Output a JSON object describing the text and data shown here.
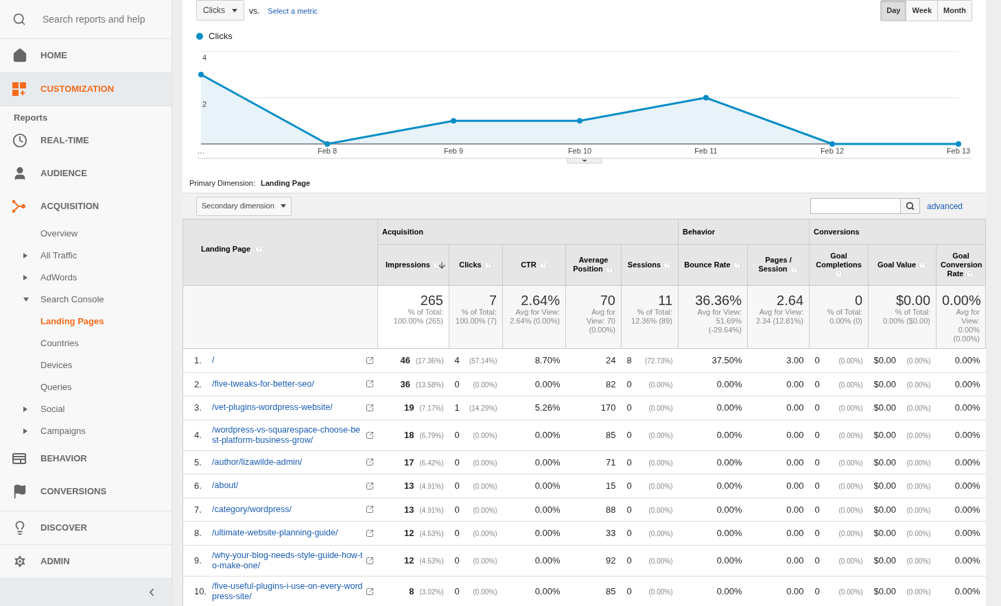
{
  "sidebar": {
    "search": {
      "placeholder": "Search reports and help"
    },
    "top_items": [
      {
        "label": "HOME",
        "selected": false
      },
      {
        "label": "CUSTOMIZATION",
        "selected": true
      }
    ],
    "section_label": "Reports",
    "report_items": [
      {
        "label": "REAL-TIME",
        "active": false
      },
      {
        "label": "AUDIENCE",
        "active": false
      },
      {
        "label": "ACQUISITION",
        "active": true,
        "children": [
          {
            "label": "Overview",
            "selected": false
          },
          {
            "label": "All Traffic",
            "selected": false,
            "expanded": false
          },
          {
            "label": "AdWords",
            "selected": false,
            "expanded": false
          },
          {
            "label": "Search Console",
            "selected": false,
            "expanded": true,
            "children": [
              {
                "label": "Landing Pages",
                "selected": true
              },
              {
                "label": "Countries",
                "selected": false
              },
              {
                "label": "Devices",
                "selected": false
              },
              {
                "label": "Queries",
                "selected": false
              }
            ]
          },
          {
            "label": "Social",
            "selected": false,
            "expanded": false
          },
          {
            "label": "Campaigns",
            "selected": false,
            "expanded": false
          }
        ]
      },
      {
        "label": "BEHAVIOR",
        "active": false
      },
      {
        "label": "CONVERSIONS",
        "active": false
      }
    ],
    "bottom_items": [
      {
        "label": "DISCOVER"
      },
      {
        "label": "ADMIN"
      }
    ]
  },
  "chart": {
    "metric_dropdown": "Clicks",
    "vs_label": "vs.",
    "compare_link": "Select a metric",
    "periods": [
      {
        "label": "Day",
        "selected": true
      },
      {
        "label": "Week",
        "selected": false
      },
      {
        "label": "Month",
        "selected": false
      }
    ],
    "chart_data": {
      "type": "area",
      "categories": [
        "…",
        "Feb 8",
        "Feb 9",
        "Feb 10",
        "Feb 11",
        "Feb 12",
        "Feb 13"
      ],
      "ylim": [
        0,
        4
      ],
      "yticks": [
        2,
        4
      ],
      "series": [
        {
          "name": "Clicks",
          "color": "#058dc7",
          "values": [
            3,
            0,
            1,
            1,
            2,
            0,
            0
          ]
        }
      ]
    }
  },
  "primary_dimension": {
    "label": "Primary Dimension:",
    "value": "Landing Page"
  },
  "toolbar": {
    "secondary_dimension": "Secondary dimension",
    "advanced_link": "advanced"
  },
  "table": {
    "first_column": "Landing Page",
    "groups": [
      {
        "label": "Acquisition",
        "columns": [
          {
            "label": "Impressions",
            "sorted": true
          },
          {
            "label": "Clicks",
            "sorted": false
          },
          {
            "label": "CTR",
            "sorted": false
          },
          {
            "label": "Average Position",
            "sorted": false
          },
          {
            "label": "Sessions",
            "sorted": false
          }
        ]
      },
      {
        "label": "Behavior",
        "columns": [
          {
            "label": "Bounce Rate",
            "sorted": false
          },
          {
            "label": "Pages / Session",
            "sorted": false
          }
        ]
      },
      {
        "label": "Conversions",
        "columns": [
          {
            "label": "Goal Completions",
            "sorted": false
          },
          {
            "label": "Goal Value",
            "sorted": false
          },
          {
            "label": "Goal Conversion Rate",
            "sorted": false
          }
        ]
      }
    ],
    "totals": [
      {
        "value": "265",
        "note": "% of Total: 100.00% (265)"
      },
      {
        "value": "7",
        "note": "% of Total: 100.00% (7)"
      },
      {
        "value": "2.64%",
        "note": "Avg for View: 2.64% (0.00%)"
      },
      {
        "value": "70",
        "note": "Avg for View: 70 (0.00%)"
      },
      {
        "value": "11",
        "note": "% of Total: 12.36% (89)"
      },
      {
        "value": "36.36%",
        "note": "Avg for View: 51.69% (-29.64%)"
      },
      {
        "value": "2.64",
        "note": "Avg for View: 2.34 (12.81%)"
      },
      {
        "value": "0",
        "note": "% of Total: 0.00% (0)"
      },
      {
        "value": "$0.00",
        "note": "% of Total: 0.00% ($0.00)"
      },
      {
        "value": "0.00%",
        "note": "Avg for View: 0.00% (0.00%)"
      }
    ],
    "rows": [
      {
        "index": "1.",
        "page": "/",
        "cells": [
          {
            "value": "46",
            "share": "(17.36%)"
          },
          {
            "value": "4",
            "share": "(57.14%)"
          },
          {
            "value": "8.70%"
          },
          {
            "value": "24"
          },
          {
            "value": "8",
            "share": "(72.73%)"
          },
          {
            "value": "37.50%"
          },
          {
            "value": "3.00"
          },
          {
            "value": "0",
            "share": "(0.00%)"
          },
          {
            "value": "$0.00",
            "share": "(0.00%)"
          },
          {
            "value": "0.00%"
          }
        ]
      },
      {
        "index": "2.",
        "page": "/five-tweaks-for-better-seo/",
        "cells": [
          {
            "value": "36",
            "share": "(13.58%)"
          },
          {
            "value": "0",
            "share": "(0.00%)"
          },
          {
            "value": "0.00%"
          },
          {
            "value": "82"
          },
          {
            "value": "0",
            "share": "(0.00%)"
          },
          {
            "value": "0.00%"
          },
          {
            "value": "0.00"
          },
          {
            "value": "0",
            "share": "(0.00%)"
          },
          {
            "value": "$0.00",
            "share": "(0.00%)"
          },
          {
            "value": "0.00%"
          }
        ]
      },
      {
        "index": "3.",
        "page": "/vet-plugins-wordpress-website/",
        "cells": [
          {
            "value": "19",
            "share": "(7.17%)"
          },
          {
            "value": "1",
            "share": "(14.29%)"
          },
          {
            "value": "5.26%"
          },
          {
            "value": "170"
          },
          {
            "value": "0",
            "share": "(0.00%)"
          },
          {
            "value": "0.00%"
          },
          {
            "value": "0.00"
          },
          {
            "value": "0",
            "share": "(0.00%)"
          },
          {
            "value": "$0.00",
            "share": "(0.00%)"
          },
          {
            "value": "0.00%"
          }
        ]
      },
      {
        "index": "4.",
        "page": "/wordpress-vs-squarespace-choose-best-platform-business-grow/",
        "cells": [
          {
            "value": "18",
            "share": "(6.79%)"
          },
          {
            "value": "0",
            "share": "(0.00%)"
          },
          {
            "value": "0.00%"
          },
          {
            "value": "85"
          },
          {
            "value": "0",
            "share": "(0.00%)"
          },
          {
            "value": "0.00%"
          },
          {
            "value": "0.00"
          },
          {
            "value": "0",
            "share": "(0.00%)"
          },
          {
            "value": "$0.00",
            "share": "(0.00%)"
          },
          {
            "value": "0.00%"
          }
        ]
      },
      {
        "index": "5.",
        "page": "/author/lizawilde-admin/",
        "cells": [
          {
            "value": "17",
            "share": "(6.42%)"
          },
          {
            "value": "0",
            "share": "(0.00%)"
          },
          {
            "value": "0.00%"
          },
          {
            "value": "71"
          },
          {
            "value": "0",
            "share": "(0.00%)"
          },
          {
            "value": "0.00%"
          },
          {
            "value": "0.00"
          },
          {
            "value": "0",
            "share": "(0.00%)"
          },
          {
            "value": "$0.00",
            "share": "(0.00%)"
          },
          {
            "value": "0.00%"
          }
        ]
      },
      {
        "index": "6.",
        "page": "/about/",
        "cells": [
          {
            "value": "13",
            "share": "(4.91%)"
          },
          {
            "value": "0",
            "share": "(0.00%)"
          },
          {
            "value": "0.00%"
          },
          {
            "value": "15"
          },
          {
            "value": "0",
            "share": "(0.00%)"
          },
          {
            "value": "0.00%"
          },
          {
            "value": "0.00"
          },
          {
            "value": "0",
            "share": "(0.00%)"
          },
          {
            "value": "$0.00",
            "share": "(0.00%)"
          },
          {
            "value": "0.00%"
          }
        ]
      },
      {
        "index": "7.",
        "page": "/category/wordpress/",
        "cells": [
          {
            "value": "13",
            "share": "(4.91%)"
          },
          {
            "value": "0",
            "share": "(0.00%)"
          },
          {
            "value": "0.00%"
          },
          {
            "value": "88"
          },
          {
            "value": "0",
            "share": "(0.00%)"
          },
          {
            "value": "0.00%"
          },
          {
            "value": "0.00"
          },
          {
            "value": "0",
            "share": "(0.00%)"
          },
          {
            "value": "$0.00",
            "share": "(0.00%)"
          },
          {
            "value": "0.00%"
          }
        ]
      },
      {
        "index": "8.",
        "page": "/ultimate-website-planning-guide/",
        "cells": [
          {
            "value": "12",
            "share": "(4.53%)"
          },
          {
            "value": "0",
            "share": "(0.00%)"
          },
          {
            "value": "0.00%"
          },
          {
            "value": "33"
          },
          {
            "value": "0",
            "share": "(0.00%)"
          },
          {
            "value": "0.00%"
          },
          {
            "value": "0.00"
          },
          {
            "value": "0",
            "share": "(0.00%)"
          },
          {
            "value": "$0.00",
            "share": "(0.00%)"
          },
          {
            "value": "0.00%"
          }
        ]
      },
      {
        "index": "9.",
        "page": "/why-your-blog-needs-style-guide-how-to-make-one/",
        "cells": [
          {
            "value": "12",
            "share": "(4.53%)"
          },
          {
            "value": "0",
            "share": "(0.00%)"
          },
          {
            "value": "0.00%"
          },
          {
            "value": "92"
          },
          {
            "value": "0",
            "share": "(0.00%)"
          },
          {
            "value": "0.00%"
          },
          {
            "value": "0.00"
          },
          {
            "value": "0",
            "share": "(0.00%)"
          },
          {
            "value": "$0.00",
            "share": "(0.00%)"
          },
          {
            "value": "0.00%"
          }
        ]
      },
      {
        "index": "10.",
        "page": "/five-useful-plugins-i-use-on-every-wordpress-site/",
        "cells": [
          {
            "value": "8",
            "share": "(3.02%)"
          },
          {
            "value": "0",
            "share": "(0.00%)"
          },
          {
            "value": "0.00%"
          },
          {
            "value": "85"
          },
          {
            "value": "0",
            "share": "(0.00%)"
          },
          {
            "value": "0.00%"
          },
          {
            "value": "0.00"
          },
          {
            "value": "0",
            "share": "(0.00%)"
          },
          {
            "value": "$0.00",
            "share": "(0.00%)"
          },
          {
            "value": "0.00%"
          }
        ]
      }
    ]
  }
}
